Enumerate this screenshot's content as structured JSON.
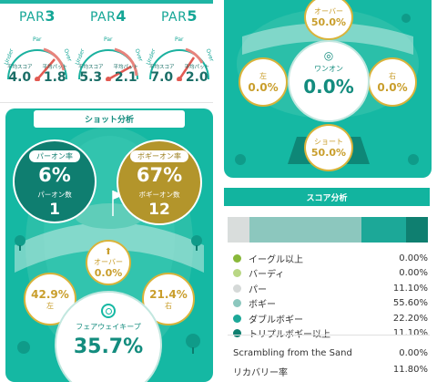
{
  "pars": [
    {
      "prefix": "PAR",
      "num": "3",
      "ticks": {
        "left": "Under",
        "top": "Par",
        "right": "Over"
      },
      "score_label": "平均スコア",
      "putt_label": "平均パット",
      "score": "4.0",
      "putt": "1.8"
    },
    {
      "prefix": "PAR",
      "num": "4",
      "ticks": {
        "left": "Under",
        "top": "Par",
        "right": "Over"
      },
      "score_label": "平均スコア",
      "putt_label": "平均パット",
      "score": "5.3",
      "putt": "2.1"
    },
    {
      "prefix": "PAR",
      "num": "5",
      "ticks": {
        "left": "Under",
        "top": "Par",
        "right": "Over"
      },
      "score_label": "平均スコア",
      "putt_label": "平均パット",
      "score": "7.0",
      "putt": "2.0"
    }
  ],
  "shot": {
    "header": "ショット分析",
    "par_on": {
      "label": "パーオン率",
      "rate": "6%",
      "count_label": "パーオン数",
      "count": "1"
    },
    "bogey_on": {
      "label": "ボギーオン率",
      "rate": "67%",
      "count_label": "ボギーオン数",
      "count": "12"
    },
    "over": {
      "label": "オーバー",
      "value": "0.0%"
    },
    "left": {
      "label": "左",
      "value": "42.9%"
    },
    "right": {
      "label": "右",
      "value": "21.4%"
    },
    "fairway": {
      "label": "フェアウェイキープ",
      "value": "35.7%"
    }
  },
  "green": {
    "over": {
      "label": "オーバー",
      "value": "50.0%"
    },
    "left": {
      "label": "左",
      "value": "0.0%"
    },
    "right": {
      "label": "右",
      "value": "0.0%"
    },
    "one_on": {
      "label": "ワンオン",
      "value": "0.0%"
    },
    "short": {
      "label": "ショート",
      "value": "50.0%"
    }
  },
  "score": {
    "header": "スコア分析",
    "bar": [
      {
        "color": "#d9dddc",
        "fraction": 0.11
      },
      {
        "color": "#8cc7be",
        "fraction": 0.556
      },
      {
        "color": "#1ca898",
        "fraction": 0.222
      },
      {
        "color": "#0f7f70",
        "fraction": 0.111
      }
    ],
    "rows": [
      {
        "label": "イーグル以上",
        "value": "0.00%",
        "color": "#89b83a"
      },
      {
        "label": "バーディ",
        "value": "0.00%",
        "color": "#b9d785"
      },
      {
        "label": "パー",
        "value": "11.10%",
        "color": "#d5d9d8"
      },
      {
        "label": "ボギー",
        "value": "55.60%",
        "color": "#8cc7be"
      },
      {
        "label": "ダブルボギー",
        "value": "22.20%",
        "color": "#1ca898"
      },
      {
        "label": "トリプルボギー以上",
        "value": "11.10%",
        "color": "#0f7f70"
      }
    ],
    "scrambling_label": "Scrambling from the Sand",
    "scrambling_value": "0.00%",
    "recovery_label": "リカバリー率",
    "recovery_value": "11.80%"
  }
}
